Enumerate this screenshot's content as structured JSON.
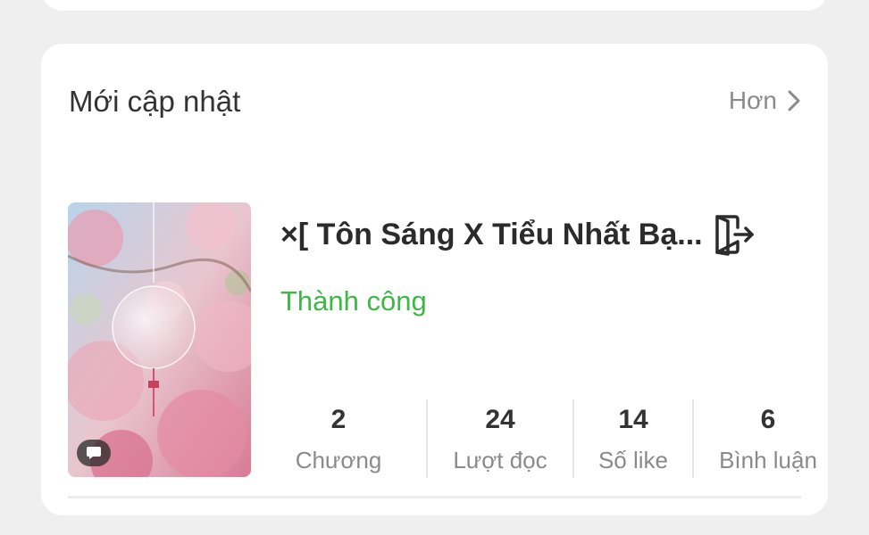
{
  "section": {
    "title": "Mới cập nhật",
    "more_label": "Hơn"
  },
  "story": {
    "title": "×[ Tôn Sáng X Tiểu Nhất Bạ...",
    "status": "Thành công",
    "status_color": "#3cb846",
    "stats": [
      {
        "value": "2",
        "label": "Chương"
      },
      {
        "value": "24",
        "label": "Lượt đọc"
      },
      {
        "value": "14",
        "label": "Số like"
      },
      {
        "value": "6",
        "label": "Bình luận"
      }
    ]
  },
  "icons": {
    "more": "chevron-right-icon",
    "open": "open-book-exit-icon",
    "badge": "comment-icon"
  }
}
